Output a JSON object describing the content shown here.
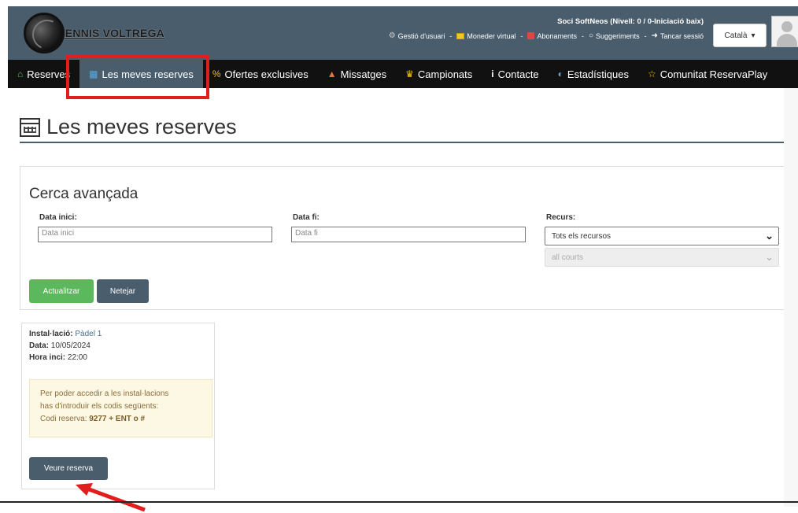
{
  "header": {
    "logo_text": "TENNIS VOLTREGÀ",
    "user_line": "Soci SoftNeos (Nivell: 0 / 0-Iniciació baix)",
    "links": [
      {
        "label": "Gestió d'usuari",
        "icon": "gear-icon"
      },
      {
        "label": "Moneder virtual",
        "icon": "wallet-icon"
      },
      {
        "label": "Abonaments",
        "icon": "edit-icon"
      },
      {
        "label": "Suggeriments",
        "icon": "comment-icon"
      },
      {
        "label": "Tancar sessió",
        "icon": "exit-icon"
      }
    ],
    "separator": "-",
    "language": "Català"
  },
  "nav": {
    "items": [
      {
        "label": "Reserves",
        "icon": "home-icon",
        "icon_color": "#5cb85c"
      },
      {
        "label": "Les meves reserves",
        "icon": "calendar-icon",
        "icon_color": "#5aa9e6",
        "active": true
      },
      {
        "label": "Ofertes exclusives",
        "icon": "percent-icon",
        "icon_color": "#f0c419"
      },
      {
        "label": "Missatges",
        "icon": "bell-icon",
        "icon_color": "#e8743b"
      },
      {
        "label": "Campionats",
        "icon": "trophy-icon",
        "icon_color": "#f0c419"
      },
      {
        "label": "Contacte",
        "icon": "info-icon",
        "icon_color": "#ffffff"
      },
      {
        "label": "Estadístiques",
        "icon": "chart-icon",
        "icon_color": "#5aa9e6"
      },
      {
        "label": "Comunitat ReservaPlay",
        "icon": "star-icon",
        "icon_color": "#f0c419"
      }
    ]
  },
  "page": {
    "title": "Les meves reserves"
  },
  "search": {
    "title": "Cerca avançada",
    "start_label": "Data inici:",
    "start_placeholder": "Data inici",
    "end_label": "Data fi:",
    "end_placeholder": "Data fi",
    "resource_label": "Recurs:",
    "resource_value": "Tots els recursos",
    "courts_value": "all courts",
    "update_button": "Actualitzar",
    "clear_button": "Netejar"
  },
  "reservation": {
    "facility_label": "Instal·lació:",
    "facility_value": "Pàdel 1",
    "date_label": "Data:",
    "date_value": "10/05/2024",
    "time_label": "Hora inci:",
    "time_value": "22:00",
    "notice_line1": "Per poder accedir a les instal·lacions",
    "notice_line2": "has d'introduir els codis següents:",
    "notice_code_label": "Codi reserva:",
    "notice_code_value": "9277 + ENT o #",
    "view_button": "Veure reserva"
  },
  "colors": {
    "header_bg": "#4a5d6c",
    "nav_bg": "#111111",
    "highlight": "#e21d1d",
    "green": "#5cb85c"
  }
}
